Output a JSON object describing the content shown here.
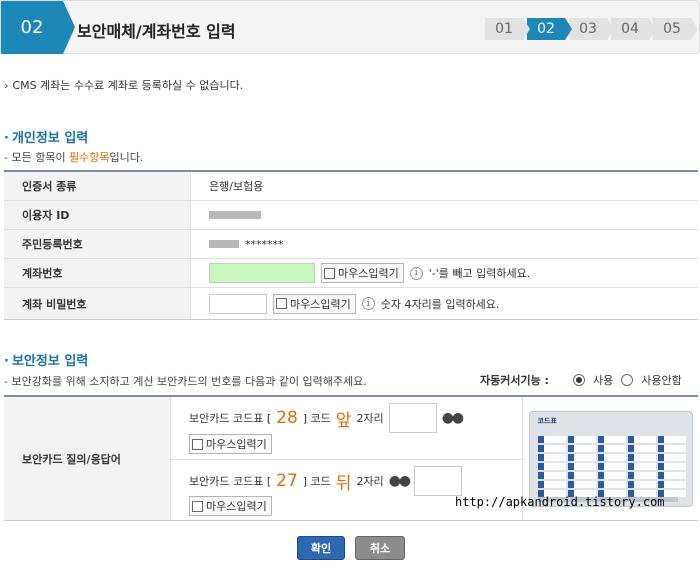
{
  "header": {
    "step_badge": "02",
    "title": "보안매체/계좌번호 입력",
    "steps": [
      "01",
      "02",
      "03",
      "04",
      "05"
    ]
  },
  "note": "CMS 계좌는 수수료 계좌로 등록하실 수 없습니다.",
  "personal": {
    "title": "개인정보 입력",
    "sub_prefix": "- 모든 항목이 ",
    "sub_required": "필수항목",
    "sub_suffix": "입니다.",
    "rows": [
      {
        "label": "인증서 종류",
        "value": "은행/보험용"
      },
      {
        "label": "이용자 ID",
        "value": ""
      },
      {
        "label": "주민등록번호",
        "value": "*******"
      },
      {
        "label": "계좌번호",
        "value": ""
      },
      {
        "label": "계좌 비밀번호",
        "value": ""
      }
    ],
    "mouse_input": "마우스입력기",
    "account_hint": "'-'를 빼고 입력하세요.",
    "password_hint": "숫자 4자리를 입력하세요."
  },
  "security": {
    "title": "보안정보 입력",
    "sub": "- 보안강화를 위해 소지하고 계신 보안카드의 번호를 다음과 같이 입력해주세요.",
    "autocursor_label": "자동커서기능 :",
    "autocursor_on": "사용",
    "autocursor_off": "사용안함",
    "row_label": "보안카드 질의/응답어",
    "q1": {
      "prefix": "보안카드 코드표 [",
      "num": "28",
      "mid": "] 코드",
      "char": "앞",
      "suffix": "2자리",
      "dots": "●●"
    },
    "q2": {
      "prefix": "보안카드 코드표 [",
      "num": "27",
      "mid": "] 코드",
      "char": "뒤",
      "suffix": "2자리",
      "dots": "●●"
    },
    "mouse_input": "마우스입력기",
    "card_title": "코드표"
  },
  "watermark": "http://apkandroid.tistory.com",
  "buttons": {
    "ok": "확인",
    "cancel": "취소"
  }
}
